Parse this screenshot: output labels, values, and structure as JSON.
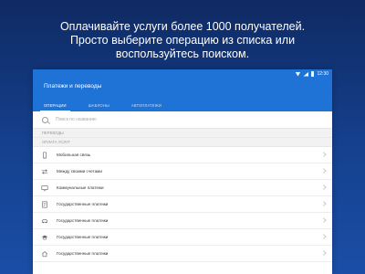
{
  "promo": {
    "lines": [
      "Оплачивайте услуги более 1000 получателей.",
      "Просто выберите операцию из списка или",
      "воспользуйтесь поиском."
    ]
  },
  "statusbar": {
    "time": "12:30"
  },
  "header": {
    "title": "Платежи и переводы",
    "tabs": [
      {
        "label": "ОПЕРАЦИИ",
        "active": true
      },
      {
        "label": "ШАБЛОНЫ",
        "active": false
      },
      {
        "label": "АВТОПЛАТЕЖИ",
        "active": false
      }
    ]
  },
  "search": {
    "placeholder": "Поиск по названию",
    "value": ""
  },
  "sections": {
    "transfers": "ПЕРЕВОДЫ",
    "services": "ОПЛАТА УСЛУГ"
  },
  "items": [
    {
      "label": "Мобильная связь",
      "icon": "phone-icon"
    },
    {
      "label": "Между своими счетами",
      "icon": "swap-arrows-icon"
    },
    {
      "label": "Коммунальные платежи",
      "icon": "tv-icon"
    },
    {
      "label": "Государственные платежи",
      "icon": "document-icon"
    },
    {
      "label": "Государственные платежи",
      "icon": "car-icon"
    },
    {
      "label": "Государственные платежи",
      "icon": "graduation-cap-icon"
    },
    {
      "label": "Государственные платежи",
      "icon": "home-icon"
    }
  ],
  "colors": {
    "background_top": "#0f2a63",
    "background_bottom": "#1a4ea6",
    "header": "#1f73d6"
  }
}
